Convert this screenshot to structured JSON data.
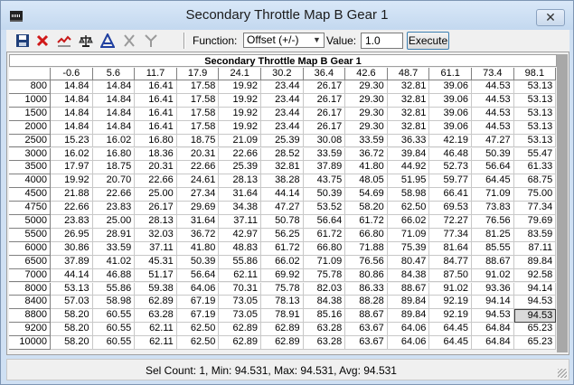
{
  "window": {
    "title": "Secondary Throttle Map B Gear 1",
    "close_glyph": "✕"
  },
  "toolbar": {
    "function_label": "Function:",
    "function_value": "Offset (+/-)",
    "value_label": "Value:",
    "value_input": "1.0",
    "execute_label": "Execute",
    "icons": [
      "save-icon",
      "delete-icon",
      "graph-icon",
      "scale-icon",
      "triangle-a-icon",
      "axis-x-icon",
      "axis-y-icon"
    ]
  },
  "table": {
    "title": "Secondary Throttle Map B Gear 1",
    "columns": [
      "-0.6",
      "5.6",
      "11.7",
      "17.9",
      "24.1",
      "30.2",
      "36.4",
      "42.6",
      "48.7",
      "61.1",
      "73.4",
      "98.1"
    ],
    "rows": [
      {
        "label": "800",
        "values": [
          "14.84",
          "14.84",
          "16.41",
          "17.58",
          "19.92",
          "23.44",
          "26.17",
          "29.30",
          "32.81",
          "39.06",
          "44.53",
          "53.13"
        ]
      },
      {
        "label": "1000",
        "values": [
          "14.84",
          "14.84",
          "16.41",
          "17.58",
          "19.92",
          "23.44",
          "26.17",
          "29.30",
          "32.81",
          "39.06",
          "44.53",
          "53.13"
        ]
      },
      {
        "label": "1500",
        "values": [
          "14.84",
          "14.84",
          "16.41",
          "17.58",
          "19.92",
          "23.44",
          "26.17",
          "29.30",
          "32.81",
          "39.06",
          "44.53",
          "53.13"
        ]
      },
      {
        "label": "2000",
        "values": [
          "14.84",
          "14.84",
          "16.41",
          "17.58",
          "19.92",
          "23.44",
          "26.17",
          "29.30",
          "32.81",
          "39.06",
          "44.53",
          "53.13"
        ]
      },
      {
        "label": "2500",
        "values": [
          "15.23",
          "16.02",
          "16.80",
          "18.75",
          "21.09",
          "25.39",
          "30.08",
          "33.59",
          "36.33",
          "42.19",
          "47.27",
          "53.13"
        ]
      },
      {
        "label": "3000",
        "values": [
          "16.02",
          "16.80",
          "18.36",
          "20.31",
          "22.66",
          "28.52",
          "33.59",
          "36.72",
          "39.84",
          "46.48",
          "50.39",
          "55.47"
        ]
      },
      {
        "label": "3500",
        "values": [
          "17.97",
          "18.75",
          "20.31",
          "22.66",
          "25.39",
          "32.81",
          "37.89",
          "41.80",
          "44.92",
          "52.73",
          "56.64",
          "61.33"
        ]
      },
      {
        "label": "4000",
        "values": [
          "19.92",
          "20.70",
          "22.66",
          "24.61",
          "28.13",
          "38.28",
          "43.75",
          "48.05",
          "51.95",
          "59.77",
          "64.45",
          "68.75"
        ]
      },
      {
        "label": "4500",
        "values": [
          "21.88",
          "22.66",
          "25.00",
          "27.34",
          "31.64",
          "44.14",
          "50.39",
          "54.69",
          "58.98",
          "66.41",
          "71.09",
          "75.00"
        ]
      },
      {
        "label": "4750",
        "values": [
          "22.66",
          "23.83",
          "26.17",
          "29.69",
          "34.38",
          "47.27",
          "53.52",
          "58.20",
          "62.50",
          "69.53",
          "73.83",
          "77.34"
        ]
      },
      {
        "label": "5000",
        "values": [
          "23.83",
          "25.00",
          "28.13",
          "31.64",
          "37.11",
          "50.78",
          "56.64",
          "61.72",
          "66.02",
          "72.27",
          "76.56",
          "79.69"
        ]
      },
      {
        "label": "5500",
        "values": [
          "26.95",
          "28.91",
          "32.03",
          "36.72",
          "42.97",
          "56.25",
          "61.72",
          "66.80",
          "71.09",
          "77.34",
          "81.25",
          "83.59"
        ]
      },
      {
        "label": "6000",
        "values": [
          "30.86",
          "33.59",
          "37.11",
          "41.80",
          "48.83",
          "61.72",
          "66.80",
          "71.88",
          "75.39",
          "81.64",
          "85.55",
          "87.11"
        ]
      },
      {
        "label": "6500",
        "values": [
          "37.89",
          "41.02",
          "45.31",
          "50.39",
          "55.86",
          "66.02",
          "71.09",
          "76.56",
          "80.47",
          "84.77",
          "88.67",
          "89.84"
        ]
      },
      {
        "label": "7000",
        "values": [
          "44.14",
          "46.88",
          "51.17",
          "56.64",
          "62.11",
          "69.92",
          "75.78",
          "80.86",
          "84.38",
          "87.50",
          "91.02",
          "92.58"
        ]
      },
      {
        "label": "8000",
        "values": [
          "53.13",
          "55.86",
          "59.38",
          "64.06",
          "70.31",
          "75.78",
          "82.03",
          "86.33",
          "88.67",
          "91.02",
          "93.36",
          "94.14"
        ]
      },
      {
        "label": "8400",
        "values": [
          "57.03",
          "58.98",
          "62.89",
          "67.19",
          "73.05",
          "78.13",
          "84.38",
          "88.28",
          "89.84",
          "92.19",
          "94.14",
          "94.53"
        ]
      },
      {
        "label": "8800",
        "values": [
          "58.20",
          "60.55",
          "63.28",
          "67.19",
          "73.05",
          "78.91",
          "85.16",
          "88.67",
          "89.84",
          "92.19",
          "94.53",
          "94.53"
        ]
      },
      {
        "label": "9200",
        "values": [
          "58.20",
          "60.55",
          "62.11",
          "62.50",
          "62.89",
          "62.89",
          "63.28",
          "63.67",
          "64.06",
          "64.45",
          "64.84",
          "65.23"
        ]
      },
      {
        "label": "10000",
        "values": [
          "58.20",
          "60.55",
          "62.11",
          "62.50",
          "62.89",
          "62.89",
          "63.28",
          "63.67",
          "64.06",
          "64.45",
          "64.84",
          "65.23"
        ]
      }
    ],
    "selected": {
      "row": 17,
      "col": 11
    }
  },
  "status": {
    "text": "Sel Count: 1, Min: 94.531, Max: 94.531, Avg: 94.531"
  }
}
